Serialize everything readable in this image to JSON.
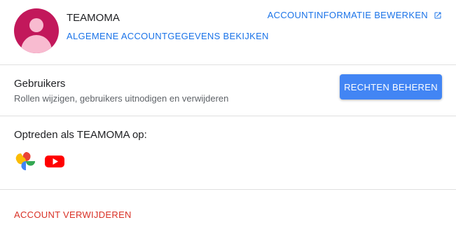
{
  "account": {
    "name": "TEAMOMA",
    "view_details_link": "ALGEMENE ACCOUNTGEGEVENS BEKIJKEN",
    "edit_info_link": "ACCOUNTINFORMATIE BEWERKEN",
    "avatar_color": "#c2185b"
  },
  "users": {
    "title": "Gebruikers",
    "subtitle": "Rollen wijzigen, gebruikers uitnodigen en verwijderen",
    "manage_button": "RECHTEN BEHEREN"
  },
  "acting_as": {
    "label": "Optreden als TEAMOMA op:",
    "apps": [
      "google-photos-icon",
      "youtube-icon"
    ]
  },
  "danger": {
    "delete_link": "ACCOUNT VERWIJDEREN"
  },
  "colors": {
    "link": "#1a73e8",
    "button": "#4285f4",
    "danger": "#d93025"
  }
}
